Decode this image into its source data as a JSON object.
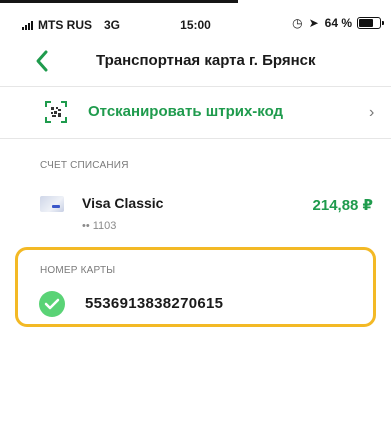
{
  "status_bar": {
    "carrier": "MTS RUS",
    "network": "3G",
    "time": "15:00",
    "battery": "64 %",
    "battery_level": 0.64
  },
  "header": {
    "title": "Транспортная карта г. Брянск",
    "back_icon": "chevron-left-icon"
  },
  "scan": {
    "label": "Отсканировать штрих-код",
    "icon": "barcode-scan-icon"
  },
  "account": {
    "section_label": "СЧЕТ СПИСАНИЯ",
    "card_name": "Visa Classic",
    "card_mask": "•• 1103",
    "amount": "214,88 ₽"
  },
  "card": {
    "section_label": "НОМЕР КАРТЫ",
    "number": "5536913838270615",
    "status_icon": "check-circle-icon"
  },
  "colors": {
    "accent": "#1f9b4d",
    "highlight": "#f3b925",
    "success": "#5ad376"
  }
}
